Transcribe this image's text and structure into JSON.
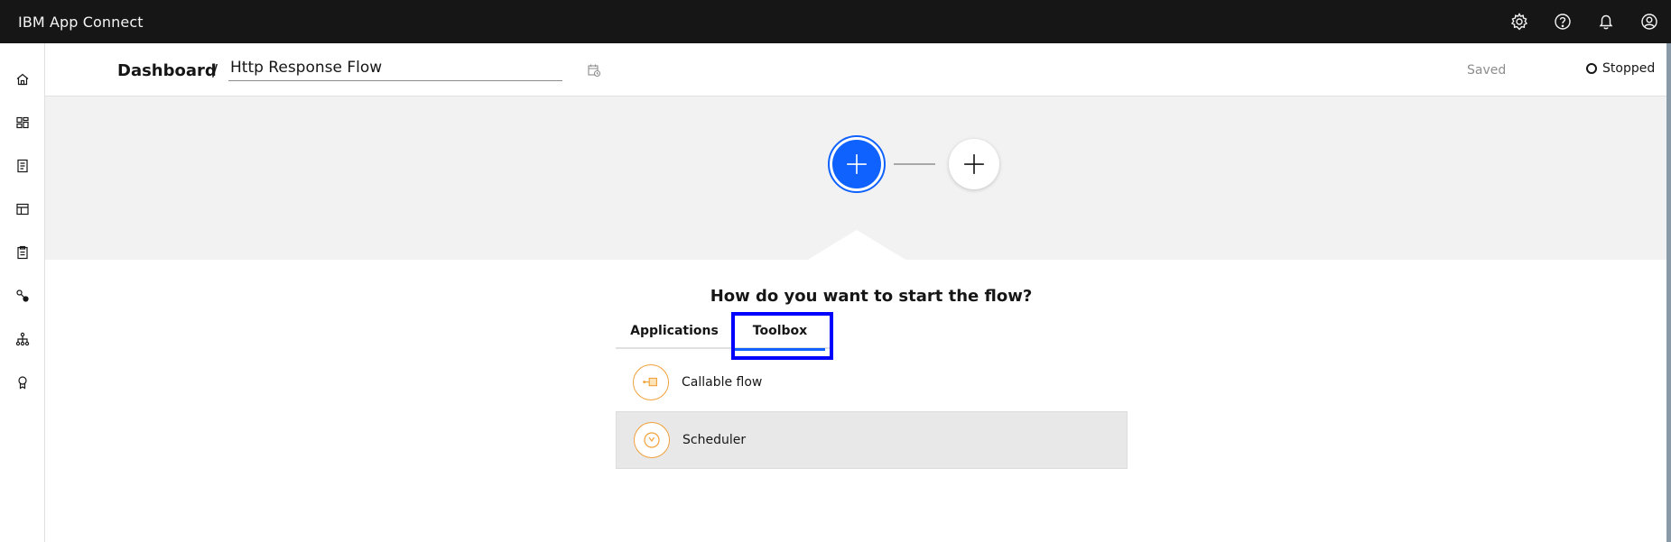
{
  "app": {
    "title": "IBM App Connect"
  },
  "topbar": {
    "icons": [
      "settings-icon",
      "help-icon",
      "notification-icon",
      "user-avatar-icon"
    ]
  },
  "sidebar": {
    "items": [
      {
        "icon": "home-icon"
      },
      {
        "icon": "dashboard-icon"
      },
      {
        "icon": "catalog-icon"
      },
      {
        "icon": "templates-icon"
      },
      {
        "icon": "clipboard-icon"
      },
      {
        "icon": "connections-icon"
      },
      {
        "icon": "hierarchy-icon"
      },
      {
        "icon": "badge-icon"
      }
    ]
  },
  "header": {
    "breadcrumb": "Dashboard",
    "separator": "/",
    "flow_name": "Http Response Flow",
    "saved_label": "Saved",
    "status_label": "Stopped"
  },
  "flow": {
    "question": "How do you want to start the flow?",
    "tabs": [
      {
        "label": "Applications",
        "active": false
      },
      {
        "label": "Toolbox",
        "active": true
      }
    ],
    "tools": [
      {
        "label": "Callable flow",
        "icon": "callable-flow-icon",
        "selected": false
      },
      {
        "label": "Scheduler",
        "icon": "clock-icon",
        "selected": true
      }
    ]
  },
  "colors": {
    "accent": "#0f62fe",
    "topbar": "#161616",
    "tool_icon": "#f1a03a",
    "highlight": "#0000ff"
  }
}
